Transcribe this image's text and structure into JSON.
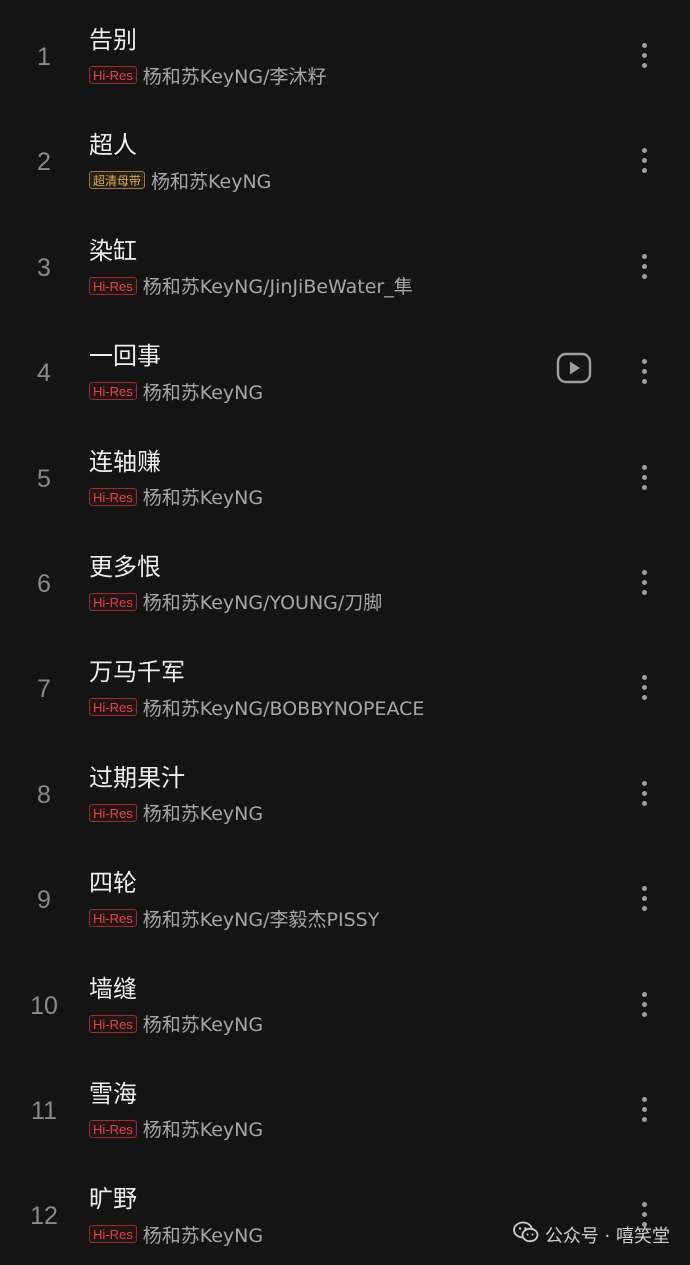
{
  "tracks": [
    {
      "index": "1",
      "title": "告别",
      "badge": "Hi-Res",
      "badge_type": "hires",
      "artist": "杨和苏KeyNG/李沐籽",
      "has_mv": false
    },
    {
      "index": "2",
      "title": "超人",
      "badge": "超清母带",
      "badge_type": "master",
      "artist": "杨和苏KeyNG",
      "has_mv": false
    },
    {
      "index": "3",
      "title": "染缸",
      "badge": "Hi-Res",
      "badge_type": "hires",
      "artist": "杨和苏KeyNG/JinJiBeWater_隼",
      "has_mv": false
    },
    {
      "index": "4",
      "title": "一回事",
      "badge": "Hi-Res",
      "badge_type": "hires",
      "artist": "杨和苏KeyNG",
      "has_mv": true
    },
    {
      "index": "5",
      "title": "连轴赚",
      "badge": "Hi-Res",
      "badge_type": "hires",
      "artist": "杨和苏KeyNG",
      "has_mv": false
    },
    {
      "index": "6",
      "title": "更多恨",
      "badge": "Hi-Res",
      "badge_type": "hires",
      "artist": "杨和苏KeyNG/YOUNG/刀脚",
      "has_mv": false
    },
    {
      "index": "7",
      "title": "万马千军",
      "badge": "Hi-Res",
      "badge_type": "hires",
      "artist": "杨和苏KeyNG/BOBBYNOPEACE",
      "has_mv": false
    },
    {
      "index": "8",
      "title": "过期果汁",
      "badge": "Hi-Res",
      "badge_type": "hires",
      "artist": "杨和苏KeyNG",
      "has_mv": false
    },
    {
      "index": "9",
      "title": "四轮",
      "badge": "Hi-Res",
      "badge_type": "hires",
      "artist": "杨和苏KeyNG/李毅杰PISSY",
      "has_mv": false
    },
    {
      "index": "10",
      "title": "墙缝",
      "badge": "Hi-Res",
      "badge_type": "hires",
      "artist": "杨和苏KeyNG",
      "has_mv": false
    },
    {
      "index": "11",
      "title": "雪海",
      "badge": "Hi-Res",
      "badge_type": "hires",
      "artist": "杨和苏KeyNG",
      "has_mv": false
    },
    {
      "index": "12",
      "title": "旷野",
      "badge": "Hi-Res",
      "badge_type": "hires",
      "artist": "杨和苏KeyNG",
      "has_mv": false
    }
  ],
  "icons": {
    "more": "more-vertical-icon",
    "mv": "play-video-icon",
    "watermark": "wechat-icon"
  },
  "watermark": {
    "text": "公众号 · 嘻笑堂"
  },
  "colors": {
    "background": "#141414",
    "hires_badge": "#e0434a",
    "master_badge": "#d8aa58"
  }
}
